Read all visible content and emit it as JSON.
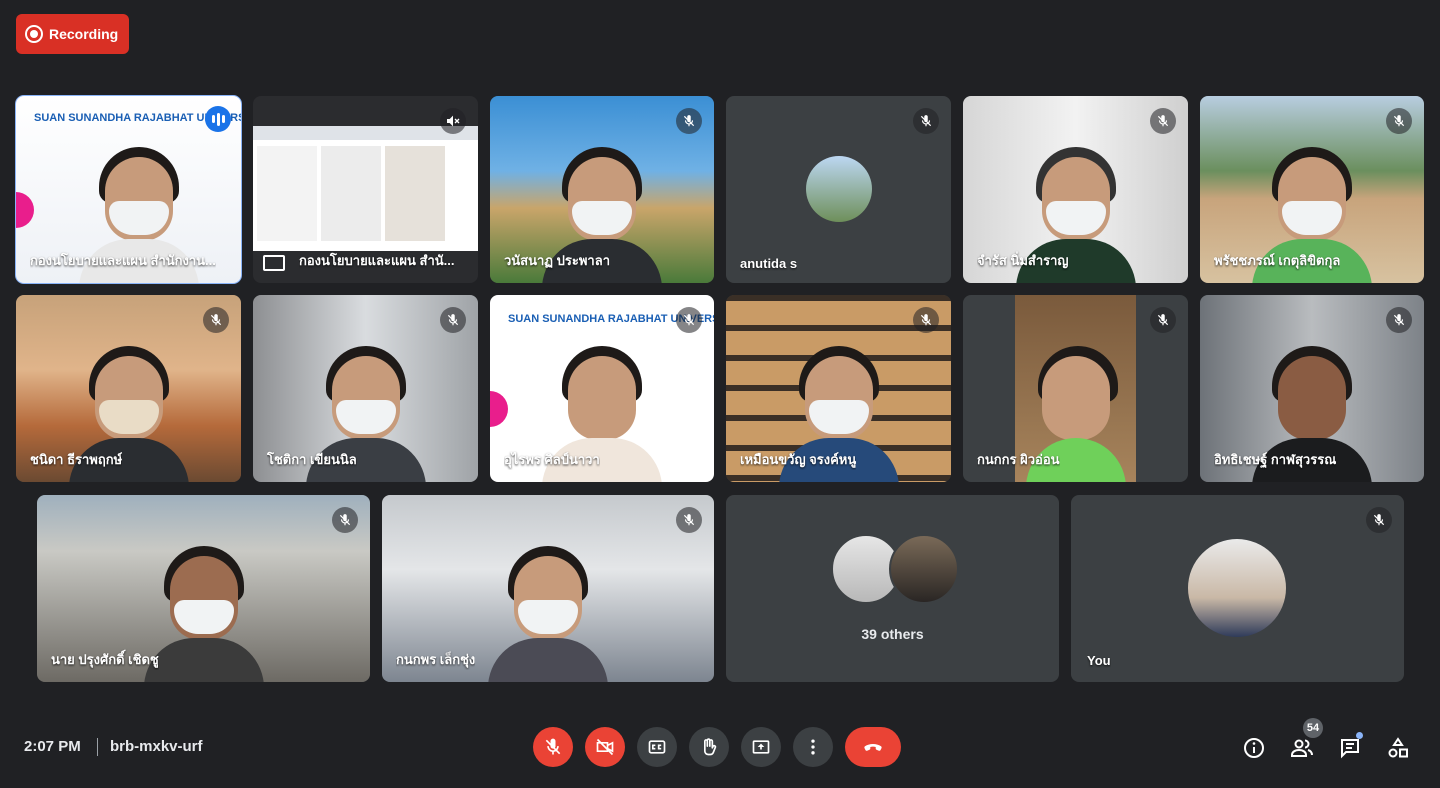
{
  "recording": {
    "label": "Recording"
  },
  "tiles": [
    {
      "name": "กองนโยบายและแผน สำนักงาน...",
      "logo": "SUAN SUNANDHA RAJABHAT UNIVERS"
    },
    {
      "name": "กองนโยบายและแผน สำนั..."
    },
    {
      "name": "วนัสนาฏ ประพาลา"
    },
    {
      "name": "anutida s"
    },
    {
      "name": "จำรัส นิ่มสำราญ"
    },
    {
      "name": "พรัชชภรณ์ เกตุลิขิตกุล"
    },
    {
      "name": "ชนิดา ธีราพฤกษ์"
    },
    {
      "name": "โชติกา เขียนนิล"
    },
    {
      "name": "อุไรพร ศิลป์นาวา",
      "logo": "SUAN SUNANDHA RAJABHAT UNIVERS"
    },
    {
      "name": "เหมือนขวัญ จรงค์หนู"
    },
    {
      "name": "กนกกร ผิวอ่อน"
    },
    {
      "name": "อิทธิเชษฐ์ กาฬสุวรรณ"
    },
    {
      "name": "นาย ปรุงศักดิ์ เชิดชู"
    },
    {
      "name": "กนกพร เล็กชุ่ง"
    },
    {
      "name": "39 others"
    },
    {
      "name": "You"
    }
  ],
  "bottom": {
    "time": "2:07 PM",
    "meeting_code": "brb-mxkv-urf",
    "participant_count": "54"
  },
  "colors": {
    "background": "#202124",
    "tile": "#3c4043",
    "red": "#ea4335",
    "accent": "#8ab4f8"
  }
}
